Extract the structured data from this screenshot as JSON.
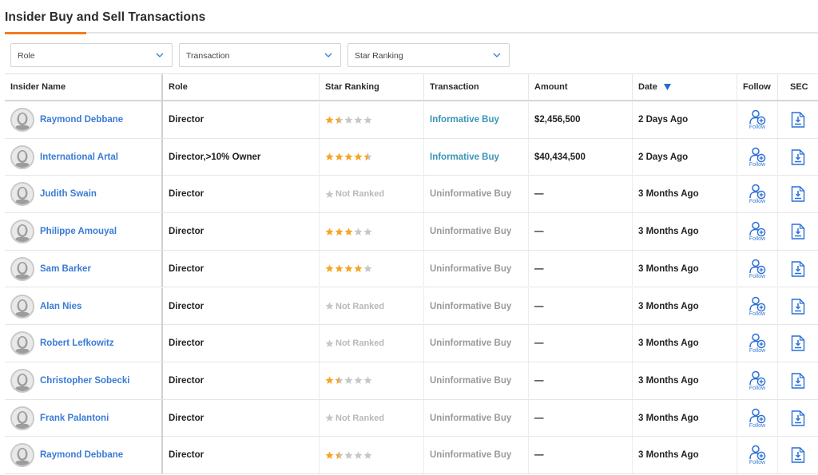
{
  "page": {
    "title": "Insider Buy and Sell Transactions",
    "accent_color": "#f47b20",
    "link_color": "#3a7bd5",
    "star_color": "#f5a623"
  },
  "filters": [
    {
      "label": "Role",
      "icon": "chevron-down-icon"
    },
    {
      "label": "Transaction",
      "icon": "chevron-down-icon"
    },
    {
      "label": "Star Ranking",
      "icon": "chevron-down-icon"
    }
  ],
  "columns": [
    "Insider Name",
    "Role",
    "Star Ranking",
    "Transaction",
    "Amount",
    "Date",
    "Follow",
    "SEC"
  ],
  "sort": {
    "column": "Date",
    "direction": "descending",
    "icon": "sort-down-triangle-icon"
  },
  "follow_label": "Follow",
  "rows": [
    {
      "name": "Raymond Debbane",
      "role": "Director",
      "stars": 1.5,
      "ranking_text": "",
      "transaction": "Informative Buy",
      "transaction_type": "informative",
      "amount": "$2,456,500",
      "date": "2 Days Ago"
    },
    {
      "name": "International Artal",
      "role": "Director,>10% Owner",
      "stars": 4.5,
      "ranking_text": "",
      "transaction": "Informative Buy",
      "transaction_type": "informative",
      "amount": "$40,434,500",
      "date": "2 Days Ago"
    },
    {
      "name": "Judith Swain",
      "role": "Director",
      "stars": 0,
      "ranking_text": "Not Ranked",
      "transaction": "Uninformative Buy",
      "transaction_type": "uninformative",
      "amount": "—",
      "date": "3 Months Ago"
    },
    {
      "name": "Philippe Amouyal",
      "role": "Director",
      "stars": 3,
      "ranking_text": "",
      "transaction": "Uninformative Buy",
      "transaction_type": "uninformative",
      "amount": "—",
      "date": "3 Months Ago"
    },
    {
      "name": "Sam Barker",
      "role": "Director",
      "stars": 4,
      "ranking_text": "",
      "transaction": "Uninformative Buy",
      "transaction_type": "uninformative",
      "amount": "—",
      "date": "3 Months Ago"
    },
    {
      "name": "Alan Nies",
      "role": "Director",
      "stars": 0,
      "ranking_text": "Not Ranked",
      "transaction": "Uninformative Buy",
      "transaction_type": "uninformative",
      "amount": "—",
      "date": "3 Months Ago"
    },
    {
      "name": "Robert Lefkowitz",
      "role": "Director",
      "stars": 0,
      "ranking_text": "Not Ranked",
      "transaction": "Uninformative Buy",
      "transaction_type": "uninformative",
      "amount": "—",
      "date": "3 Months Ago"
    },
    {
      "name": "Christopher Sobecki",
      "role": "Director",
      "stars": 1.5,
      "ranking_text": "",
      "transaction": "Uninformative Buy",
      "transaction_type": "uninformative",
      "amount": "—",
      "date": "3 Months Ago"
    },
    {
      "name": "Frank Palantoni",
      "role": "Director",
      "stars": 0,
      "ranking_text": "Not Ranked",
      "transaction": "Uninformative Buy",
      "transaction_type": "uninformative",
      "amount": "—",
      "date": "3 Months Ago"
    },
    {
      "name": "Raymond Debbane",
      "role": "Director",
      "stars": 1.5,
      "ranking_text": "",
      "transaction": "Uninformative Buy",
      "transaction_type": "uninformative",
      "amount": "—",
      "date": "3 Months Ago"
    }
  ]
}
